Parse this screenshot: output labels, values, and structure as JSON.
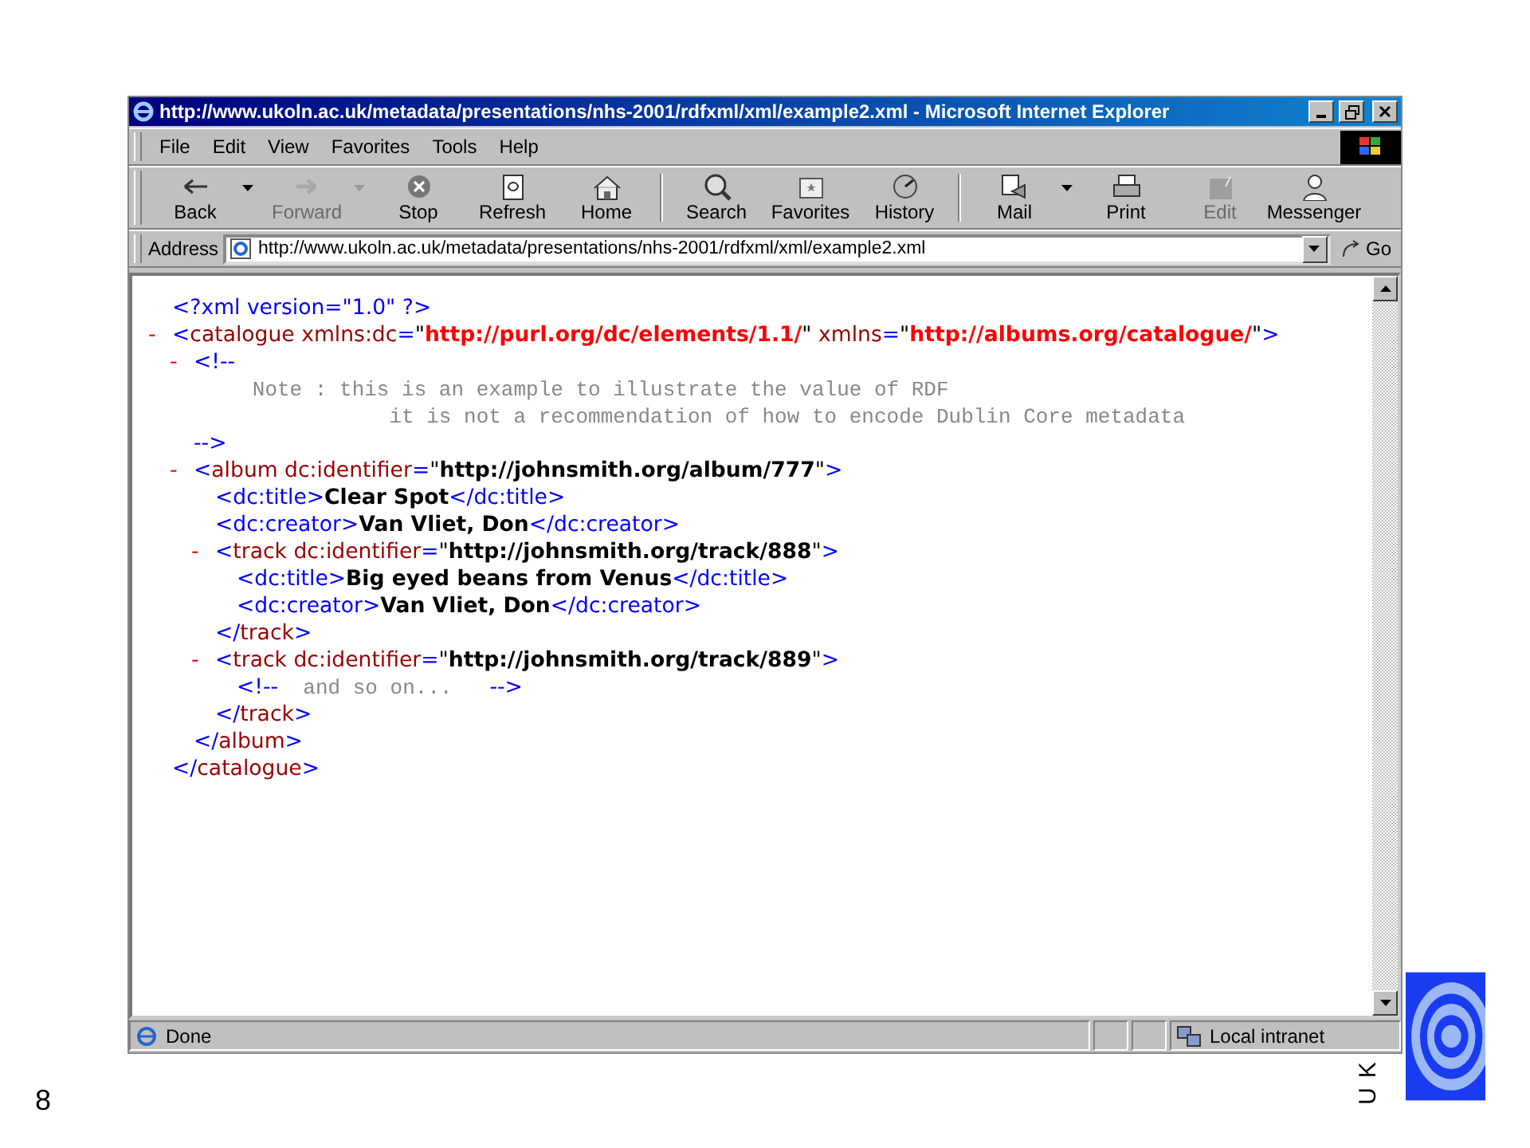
{
  "window": {
    "title": "http://www.ukoln.ac.uk/metadata/presentations/nhs-2001/rdfxml/xml/example2.xml - Microsoft Internet Explorer"
  },
  "menu": [
    "File",
    "Edit",
    "View",
    "Favorites",
    "Tools",
    "Help"
  ],
  "toolbar": {
    "groups": [
      [
        {
          "label": "Back",
          "disabled": false,
          "has_menu": true
        },
        {
          "label": "Forward",
          "disabled": true,
          "has_menu": true
        },
        {
          "label": "Stop",
          "disabled": false,
          "has_menu": false
        },
        {
          "label": "Refresh",
          "disabled": false,
          "has_menu": false
        },
        {
          "label": "Home",
          "disabled": false,
          "has_menu": false
        }
      ],
      [
        {
          "label": "Search",
          "disabled": false,
          "has_menu": false
        },
        {
          "label": "Favorites",
          "disabled": false,
          "has_menu": false
        },
        {
          "label": "History",
          "disabled": false,
          "has_menu": false
        }
      ],
      [
        {
          "label": "Mail",
          "disabled": false,
          "has_menu": true
        },
        {
          "label": "Print",
          "disabled": false,
          "has_menu": false
        },
        {
          "label": "Edit",
          "disabled": true,
          "has_menu": false
        },
        {
          "label": "Messenger",
          "disabled": false,
          "has_menu": false
        }
      ]
    ]
  },
  "address_bar": {
    "label": "Address",
    "value": "http://www.ukoln.ac.uk/metadata/presentations/nhs-2001/rdfxml/xml/example2.xml",
    "go": "Go"
  },
  "document": {
    "nodes": [
      {
        "line": [
          {
            "kind": "mark",
            "text": "<?xml version=\"1.0\" ?>"
          }
        ]
      },
      {
        "toggle": "-",
        "line": [
          {
            "kind": "mark",
            "text": "<"
          },
          {
            "kind": "name",
            "text": "catalogue xmlns:dc"
          },
          {
            "kind": "mark",
            "text": "="
          },
          {
            "kind": "quote",
            "text": "\""
          },
          {
            "kind": "nsvalue",
            "text": "http://purl.org/dc/elements/1.1/"
          },
          {
            "kind": "quote",
            "text": "\""
          },
          {
            "kind": "name",
            "text": " xmlns"
          },
          {
            "kind": "mark",
            "text": "="
          },
          {
            "kind": "quote",
            "text": "\""
          },
          {
            "kind": "nsvalue",
            "text": "http://albums.org/catalogue/"
          },
          {
            "kind": "quote",
            "text": "\""
          },
          {
            "kind": "mark",
            "text": ">"
          }
        ],
        "children": [
          {
            "toggle": "-",
            "line": [
              {
                "kind": "mark",
                "text": "<!--"
              }
            ],
            "children": [
              {
                "line": [
                  {
                    "kind": "comment",
                    "text": "   Note : this is an example to illustrate the value of RDF"
                  }
                ]
              },
              {
                "line": [
                  {
                    "kind": "comment",
                    "text": "              it is not a recommendation of how to encode Dublin Core metadata"
                  }
                ]
              }
            ],
            "end": [
              {
                "kind": "mark",
                "text": "-->"
              }
            ]
          },
          {
            "toggle": "-",
            "line": [
              {
                "kind": "mark",
                "text": "<"
              },
              {
                "kind": "name",
                "text": "album dc:identifier"
              },
              {
                "kind": "mark",
                "text": "="
              },
              {
                "kind": "quote",
                "text": "\""
              },
              {
                "kind": "value",
                "text": "http://johnsmith.org/album/777"
              },
              {
                "kind": "quote",
                "text": "\""
              },
              {
                "kind": "mark",
                "text": ">"
              }
            ],
            "children": [
              {
                "line": [
                  {
                    "kind": "mark",
                    "text": "<dc:title>"
                  },
                  {
                    "kind": "value",
                    "text": "Clear Spot"
                  },
                  {
                    "kind": "mark",
                    "text": "</dc:title>"
                  }
                ]
              },
              {
                "line": [
                  {
                    "kind": "mark",
                    "text": "<dc:creator>"
                  },
                  {
                    "kind": "value",
                    "text": "Van Vliet, Don"
                  },
                  {
                    "kind": "mark",
                    "text": "</dc:creator>"
                  }
                ]
              },
              {
                "toggle": "-",
                "line": [
                  {
                    "kind": "mark",
                    "text": "<"
                  },
                  {
                    "kind": "name",
                    "text": "track dc:identifier"
                  },
                  {
                    "kind": "mark",
                    "text": "="
                  },
                  {
                    "kind": "quote",
                    "text": "\""
                  },
                  {
                    "kind": "value",
                    "text": "http://johnsmith.org/track/888"
                  },
                  {
                    "kind": "quote",
                    "text": "\""
                  },
                  {
                    "kind": "mark",
                    "text": ">"
                  }
                ],
                "children": [
                  {
                    "line": [
                      {
                        "kind": "mark",
                        "text": "<dc:title>"
                      },
                      {
                        "kind": "value",
                        "text": "Big eyed beans from Venus"
                      },
                      {
                        "kind": "mark",
                        "text": "</dc:title>"
                      }
                    ]
                  },
                  {
                    "line": [
                      {
                        "kind": "mark",
                        "text": "<dc:creator>"
                      },
                      {
                        "kind": "value",
                        "text": "Van Vliet, Don"
                      },
                      {
                        "kind": "mark",
                        "text": "</dc:creator>"
                      }
                    ]
                  }
                ],
                "end": [
                  {
                    "kind": "mark",
                    "text": "</"
                  },
                  {
                    "kind": "name",
                    "text": "track"
                  },
                  {
                    "kind": "mark",
                    "text": ">"
                  }
                ]
              },
              {
                "toggle": "-",
                "line": [
                  {
                    "kind": "mark",
                    "text": "<"
                  },
                  {
                    "kind": "name",
                    "text": "track dc:identifier"
                  },
                  {
                    "kind": "mark",
                    "text": "="
                  },
                  {
                    "kind": "quote",
                    "text": "\""
                  },
                  {
                    "kind": "value",
                    "text": "http://johnsmith.org/track/889"
                  },
                  {
                    "kind": "quote",
                    "text": "\""
                  },
                  {
                    "kind": "mark",
                    "text": ">"
                  }
                ],
                "children": [
                  {
                    "line": [
                      {
                        "kind": "mark",
                        "text": "<!--"
                      },
                      {
                        "kind": "comment",
                        "text": "  and so on...   "
                      },
                      {
                        "kind": "mark",
                        "text": "-->"
                      }
                    ]
                  }
                ],
                "end": [
                  {
                    "kind": "mark",
                    "text": "</"
                  },
                  {
                    "kind": "name",
                    "text": "track"
                  },
                  {
                    "kind": "mark",
                    "text": ">"
                  }
                ]
              }
            ],
            "end": [
              {
                "kind": "mark",
                "text": "</"
              },
              {
                "kind": "name",
                "text": "album"
              },
              {
                "kind": "mark",
                "text": ">"
              }
            ]
          }
        ],
        "end": [
          {
            "kind": "mark",
            "text": "</"
          },
          {
            "kind": "name",
            "text": "catalogue"
          },
          {
            "kind": "mark",
            "text": ">"
          }
        ]
      }
    ]
  },
  "status_bar": {
    "status": "Done",
    "zone": "Local intranet"
  },
  "slide": {
    "page_number": "8",
    "logo_text": "UK"
  }
}
